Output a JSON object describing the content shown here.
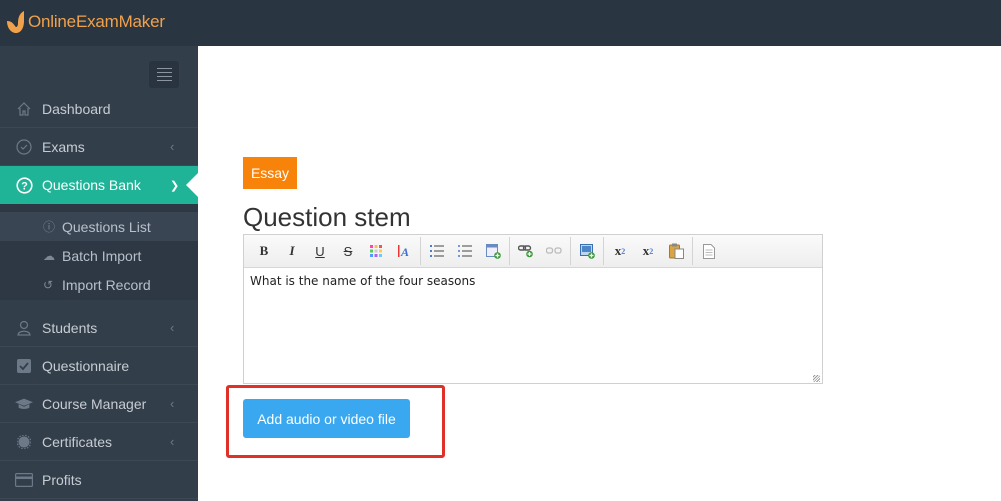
{
  "brand": {
    "name": "OnlineExamMaker",
    "logo_color": "#f0a14a"
  },
  "sidebar": {
    "toggle_icon": "hamburger-menu-icon",
    "items": [
      {
        "label": "Dashboard",
        "icon": "home-icon",
        "has_chevron": false
      },
      {
        "label": "Exams",
        "icon": "check-circle-icon",
        "has_chevron": true
      },
      {
        "label": "Questions Bank",
        "icon": "question-circle-icon",
        "has_chevron": true,
        "active": true
      },
      {
        "label": "Students",
        "icon": "user-icon",
        "has_chevron": true
      },
      {
        "label": "Questionnaire",
        "icon": "checkbox-icon",
        "has_chevron": false
      },
      {
        "label": "Course Manager",
        "icon": "graduation-cap-icon",
        "has_chevron": true
      },
      {
        "label": "Certificates",
        "icon": "certificate-icon",
        "has_chevron": true
      },
      {
        "label": "Profits",
        "icon": "credit-card-icon",
        "has_chevron": false
      }
    ],
    "submenu": [
      {
        "label": "Questions List",
        "icon": "question-circle-icon",
        "active": true
      },
      {
        "label": "Batch Import",
        "icon": "cloud-upload-icon"
      },
      {
        "label": "Import Record",
        "icon": "history-icon"
      }
    ],
    "active_color": "#1fb497"
  },
  "main": {
    "question_type_badge": "Essay",
    "badge_color": "#f7830b",
    "section_title": "Question stem",
    "editor": {
      "toolbar": [
        "bold",
        "italic",
        "underline",
        "strikethrough",
        "background-color",
        "text-color",
        "ordered-list",
        "unordered-list",
        "insert-table",
        "insert-link",
        "unlink",
        "insert-image",
        "superscript",
        "subscript",
        "paste",
        "source"
      ],
      "content": "What is the name of the four seasons"
    },
    "add_media_button": "Add audio or video file",
    "button_color": "#3aa8f0",
    "highlight_color": "#e0302a"
  }
}
